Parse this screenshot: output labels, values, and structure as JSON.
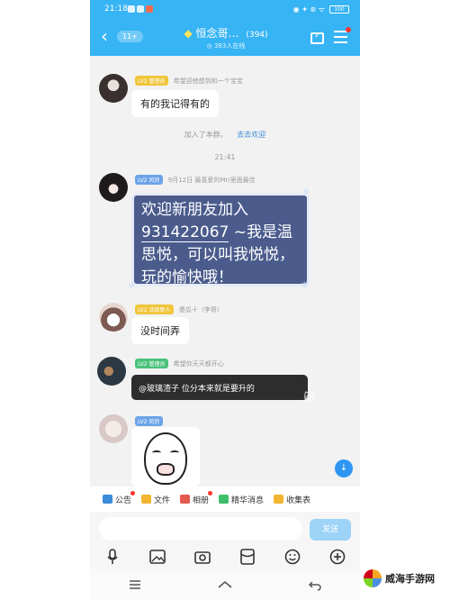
{
  "status": {
    "time": "21:18",
    "right": "◉ ✦ ⊛ ᯤ",
    "battery": "100"
  },
  "header": {
    "back": "‹",
    "unread": "11+",
    "title": "恒念哥…",
    "gem": "◆",
    "member_count": "(394)",
    "subtitle": "◎ 383人在线"
  },
  "chat": {
    "messages": [
      {
        "badge": "LV2 管理员",
        "sender": "希望迎他想到和一个宝宝",
        "text": "有的我记得有的"
      },
      {
        "badge": "LV2 风铃",
        "sender": "9月12日 最喜爱的Mr/里面最佳",
        "text_prefix": "欢迎新朋友加入",
        "number": "931422067",
        "text_suffix": "~我是温思悦，可以叫我悦悦，玩的愉快哦！"
      },
      {
        "badge": "LV2 活跃新人",
        "sender": "傻瓜十（李哥）",
        "text": "没时间弄"
      },
      {
        "badge": "LV2 管理员",
        "sender": "希望你天天都开心",
        "text": "@玻璃渣子 位分本来就是要升的"
      },
      {
        "badge": "LV2 风铃",
        "sender": "",
        "text": ""
      }
    ],
    "system_join": "加入了本群。",
    "system_link": "去去欢迎",
    "timestamp": "21:41",
    "scroll_icon": "↓"
  },
  "quick_bar": [
    {
      "label": "公告",
      "color": "#3a8bd8"
    },
    {
      "label": "文件",
      "color": "#f2b431"
    },
    {
      "label": "相册",
      "color": "#e4584e"
    },
    {
      "label": "精华消息",
      "color": "#3fbf6a"
    },
    {
      "label": "收集表",
      "color": "#f2b431"
    }
  ],
  "input": {
    "placeholder": "",
    "send": "发送"
  },
  "watermark": "威海手游网"
}
